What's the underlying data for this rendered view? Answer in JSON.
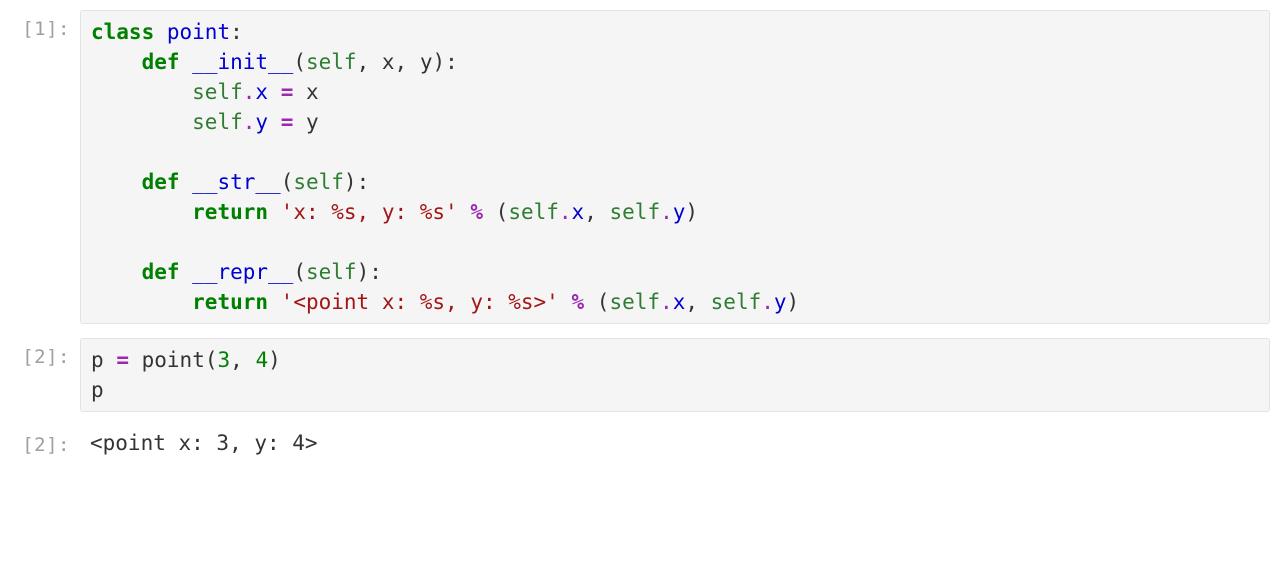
{
  "cells": {
    "c1": {
      "prompt": "[1]:",
      "tokens": {
        "kw_class": "class",
        "name_point": "point",
        "colon": ":",
        "kw_def": "def",
        "fn_init": "__init__",
        "lp": "(",
        "self": "self",
        "comma": ",",
        "sp": " ",
        "x": "x",
        "y": "y",
        "rp": ")",
        "attr_x": "x",
        "attr_y": "y",
        "eq": "=",
        "dot": ".",
        "fn_str": "__str__",
        "kw_return": "return",
        "str_str": "'x: %s, y: %s'",
        "pct": "%",
        "fn_repr": "__repr__",
        "str_repr": "'<point x: %s, y: %s>'"
      }
    },
    "c2": {
      "prompt": "[2]:",
      "tokens": {
        "p": "p",
        "sp": " ",
        "eq": "=",
        "name_point": "point",
        "lp": "(",
        "n3": "3",
        "comma": ",",
        "n4": "4",
        "rp": ")"
      }
    },
    "out2": {
      "prompt": "[2]:",
      "text": "<point x: 3, y: 4>"
    }
  }
}
